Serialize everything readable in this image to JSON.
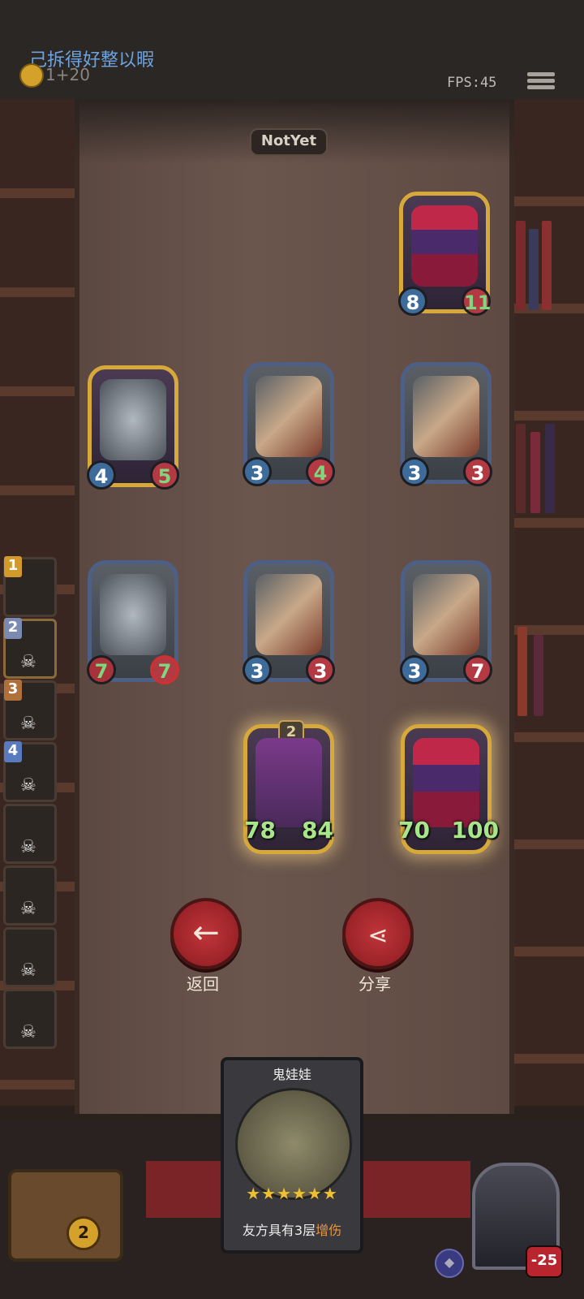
{
  "header": {
    "title": "己拆得好整以暇",
    "coin_text": "1+20",
    "fps": "FPS:45",
    "menu_icon": "hamburger-menu-icon"
  },
  "status_badge": "NotYet",
  "board": {
    "cards": [
      {
        "name": "clown",
        "attack": "8",
        "health": "11"
      },
      {
        "name": "robot",
        "attack": "4",
        "health": "5"
      },
      {
        "name": "rocket",
        "attack": "3",
        "health": "4"
      },
      {
        "name": "rocket",
        "attack": "3",
        "health": "3"
      },
      {
        "name": "robot",
        "attack": "7",
        "health": "7"
      },
      {
        "name": "rocket",
        "attack": "3",
        "health": "3"
      },
      {
        "name": "rocket",
        "attack": "3",
        "health": "7"
      },
      {
        "name": "rat",
        "attack": "78",
        "health": "84",
        "tier": "2"
      },
      {
        "name": "clown",
        "attack": "70",
        "health": "100"
      }
    ]
  },
  "sidebar": {
    "players": [
      {
        "rank": "1",
        "color": "#d19a2a"
      },
      {
        "rank": "2",
        "color": "#7a8ab0"
      },
      {
        "rank": "3",
        "color": "#b0703a"
      },
      {
        "rank": "4",
        "color": "#5a7ac0"
      },
      {
        "rank": ""
      },
      {
        "rank": ""
      },
      {
        "rank": ""
      },
      {
        "rank": ""
      }
    ]
  },
  "buttons": {
    "back_label": "返回",
    "share_label": "分享"
  },
  "deck": {
    "name": "鬼娃娃",
    "stars": "★★★★★★",
    "desc_prefix": "友方具有3层",
    "desc_keyword": "增伤"
  },
  "footer": {
    "coins": "2",
    "hero_health": "-25"
  }
}
